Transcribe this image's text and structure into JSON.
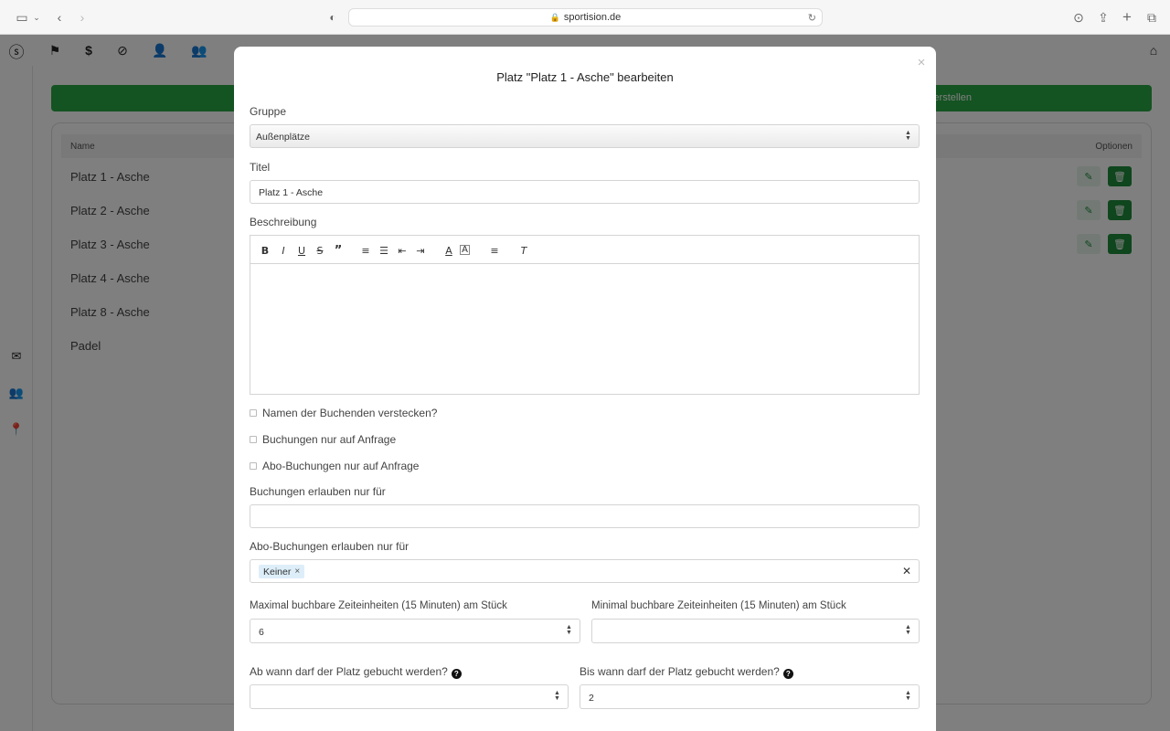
{
  "browser": {
    "url": "sportision.de"
  },
  "app": {
    "create_button_partial": "erstellen",
    "table": {
      "col_name": "Name",
      "col_options": "Optionen",
      "rows": [
        "Platz 1 - Asche",
        "Platz 2 - Asche",
        "Platz 3 - Asche",
        "Platz 4 - Asche",
        "Platz 8 - Asche",
        "Padel"
      ]
    },
    "accent_color": "#28a745"
  },
  "modal": {
    "title": "Platz \"Platz 1 - Asche\" bearbeiten",
    "group_label": "Gruppe",
    "group_value": "Außenplätze",
    "title_label": "Titel",
    "title_value": "Platz 1 - Asche",
    "description_label": "Beschreibung",
    "checkbox_hide_names": "Namen der Buchenden verstecken?",
    "checkbox_on_request": "Buchungen nur auf Anfrage",
    "checkbox_abo_on_request": "Abo-Buchungen nur auf Anfrage",
    "allow_bookings_label": "Buchungen erlauben nur für",
    "allow_abo_label": "Abo-Buchungen erlauben nur für",
    "allow_abo_tag": "Keiner",
    "max_units_label": "Maximal buchbare Zeiteinheiten (15 Minuten) am Stück",
    "max_units_value": "6",
    "min_units_label": "Minimal buchbare Zeiteinheiten (15 Minuten) am Stück",
    "min_units_value": "",
    "from_when_label": "Ab wann darf der Platz gebucht werden?",
    "from_when_value": "",
    "until_when_label": "Bis wann darf der Platz gebucht werden?",
    "until_when_value": "2"
  }
}
